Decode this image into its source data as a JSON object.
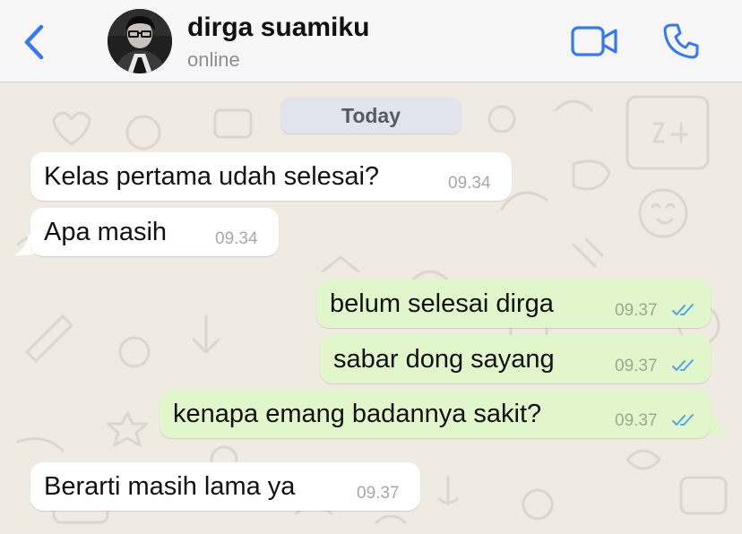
{
  "header": {
    "contact_name": "dirga suamiku",
    "status": "online",
    "icons": {
      "back": "chevron-left-icon",
      "video": "video-camera-icon",
      "call": "phone-icon"
    },
    "accent_color": "#3478f6"
  },
  "chat": {
    "date_separator": "Today",
    "messages": [
      {
        "direction": "incoming",
        "text": "Kelas pertama udah selesai?",
        "time": "09.34"
      },
      {
        "direction": "incoming",
        "text": "Apa masih",
        "time": "09.34"
      },
      {
        "direction": "outgoing",
        "text": "belum selesai dirga",
        "time": "09.37",
        "status": "read"
      },
      {
        "direction": "outgoing",
        "text": "sabar dong sayang",
        "time": "09.37",
        "status": "read"
      },
      {
        "direction": "outgoing",
        "text": "kenapa emang badannya sakit?",
        "time": "09.37",
        "status": "read"
      },
      {
        "direction": "incoming",
        "text": "Berarti masih lama ya",
        "time": "09.37"
      }
    ],
    "colors": {
      "incoming_bubble": "#ffffff",
      "outgoing_bubble": "#e1f7cb",
      "read_ticks": "#4fa4e8",
      "wallpaper": "#efeae2"
    }
  }
}
